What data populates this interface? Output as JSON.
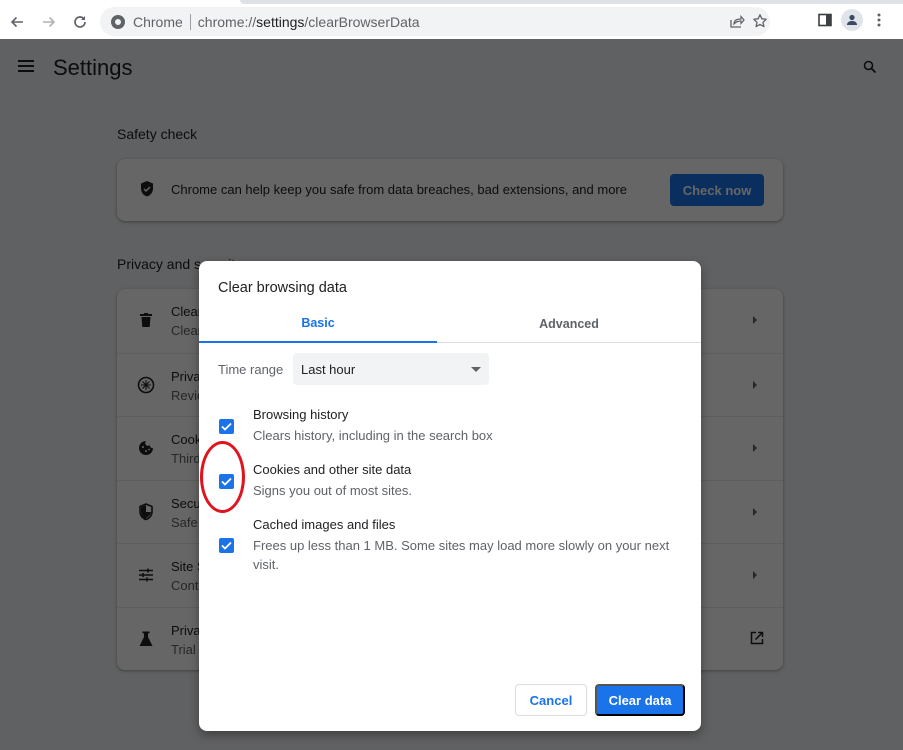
{
  "browser": {
    "back_icon": "arrow-left",
    "forward_icon": "arrow-right",
    "reload_icon": "reload",
    "site_name": "Chrome",
    "url_prefix": "chrome://",
    "url_host": "settings",
    "url_path": "/clearBrowserData",
    "share_icon": "share",
    "bookmark_icon": "star",
    "sidepanel_icon": "side-panel",
    "profile_icon": "person",
    "menu_icon": "three-dots-vertical"
  },
  "settings": {
    "title": "Settings",
    "safety_check": {
      "heading": "Safety check",
      "description": "Chrome can help keep you safe from data breaches, bad extensions, and more",
      "button": "Check now"
    },
    "privacy": {
      "heading": "Privacy and security",
      "rows": [
        {
          "title": "Clear",
          "subtitle": "Clear",
          "icon": "trash",
          "action": "arrow"
        },
        {
          "title": "Priva",
          "subtitle": "Revie",
          "icon": "compass",
          "action": "arrow"
        },
        {
          "title": "Cook",
          "subtitle": "Third",
          "icon": "cookie",
          "action": "arrow"
        },
        {
          "title": "Secu",
          "subtitle": "Safe",
          "icon": "shield",
          "action": "arrow"
        },
        {
          "title": "Site S",
          "subtitle": "Cont",
          "icon": "sliders",
          "action": "arrow"
        },
        {
          "title": "Priva",
          "subtitle": "Trial",
          "icon": "flask",
          "action": "external-link"
        }
      ]
    }
  },
  "dialog": {
    "title": "Clear browsing data",
    "tabs": [
      {
        "label": "Basic",
        "active": true
      },
      {
        "label": "Advanced",
        "active": false
      }
    ],
    "time_range_label": "Time range",
    "time_range_value": "Last hour",
    "options": [
      {
        "title": "Browsing history",
        "description": "Clears history, including in the search box",
        "checked": true
      },
      {
        "title": "Cookies and other site data",
        "description": "Signs you out of most sites.",
        "checked": true
      },
      {
        "title": "Cached images and files",
        "description": "Frees up less than 1 MB. Some sites may load more slowly on your next visit.",
        "checked": true
      }
    ],
    "cancel_label": "Cancel",
    "confirm_label": "Clear data"
  },
  "colors": {
    "accent": "#1a73e8",
    "annotation": "#e0141e"
  }
}
